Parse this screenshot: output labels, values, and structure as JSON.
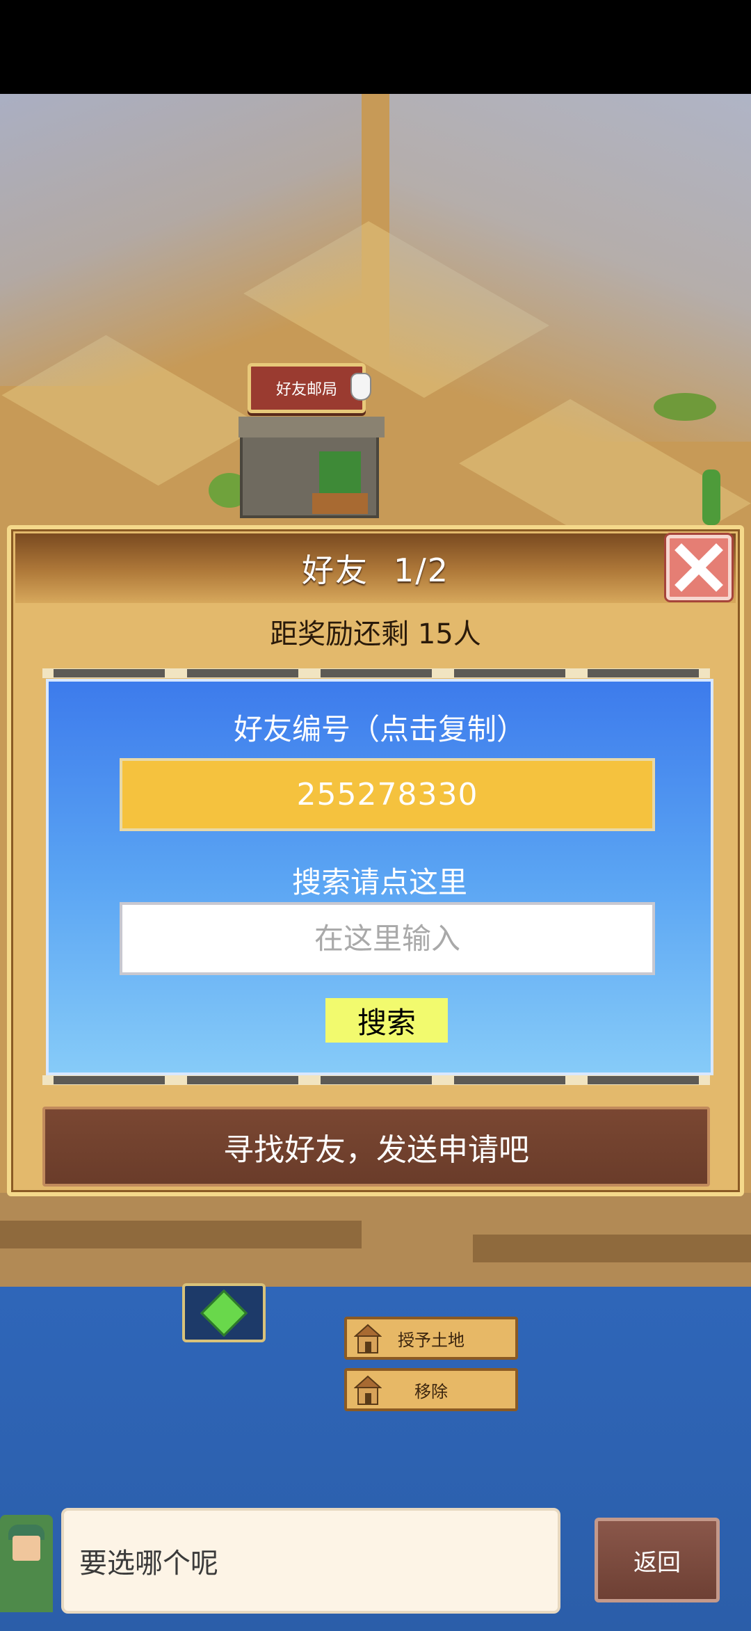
{
  "map": {
    "building_sign_label": "好友邮局"
  },
  "dialog_panel": {
    "title": "好友",
    "page_indicator": "1/2",
    "reward_text": "距奖励还剩 15人",
    "friend_id_label": "好友编号（点击复制）",
    "friend_id_value": "255278330",
    "search_label": "搜索请点这里",
    "search_placeholder": "在这里输入",
    "search_button": "搜索",
    "find_friends_button": "寻找好友，发送申请吧"
  },
  "land_actions": {
    "grant_label": "授予土地",
    "remove_label": "移除"
  },
  "bottom": {
    "message": "要选哪个呢",
    "back_button": "返回"
  },
  "icons": [
    "close-icon",
    "arrow-left-icon",
    "arrow-right-icon",
    "house-icon",
    "gem-icon",
    "hand-pointer-icon"
  ],
  "colors": {
    "panel_header": "#7a4a20",
    "blue_panel": "#3d7bec",
    "id_box": "#f5c23e",
    "search_button": "#f2fa6e",
    "find_button": "#6a3c2a",
    "close_button": "#e57e74"
  }
}
